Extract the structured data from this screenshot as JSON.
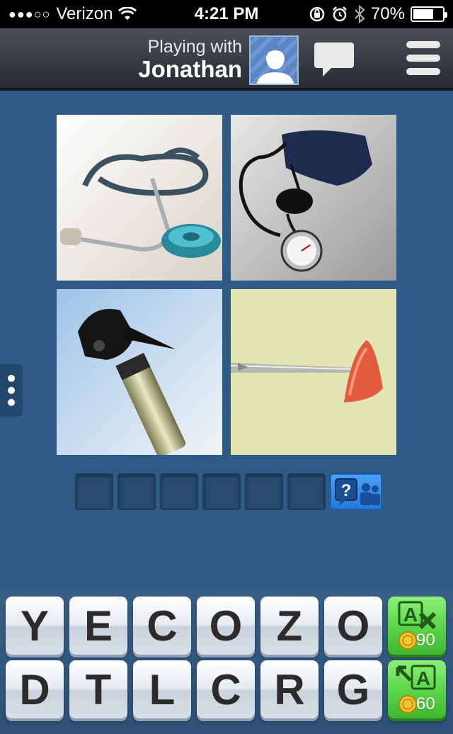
{
  "status_bar": {
    "signal_dots": "●●●○○",
    "carrier": "Verizon",
    "time": "4:21 PM",
    "battery_text": "70%",
    "battery_level": 0.7
  },
  "header": {
    "playing_label": "Playing with",
    "player_name": "Jonathan",
    "icons": [
      "avatar-icon",
      "chat-icon",
      "menu-icon"
    ]
  },
  "puzzle": {
    "images": [
      "stethoscope",
      "blood-pressure-cuff",
      "otoscope",
      "reflex-hammer"
    ],
    "answer_slots": 6,
    "hint_button_icons": [
      "question-bubble-icon",
      "friends-icon"
    ]
  },
  "keyboard": {
    "row1": [
      "Y",
      "E",
      "C",
      "O",
      "Z",
      "O"
    ],
    "row2": [
      "D",
      "T",
      "L",
      "C",
      "R",
      "G"
    ],
    "remove_letters_cost": "90",
    "reveal_letter_cost": "60"
  },
  "colors": {
    "background": "#2e5a86",
    "power_green": "#5ed64a",
    "hint_blue": "#2f86e6"
  }
}
